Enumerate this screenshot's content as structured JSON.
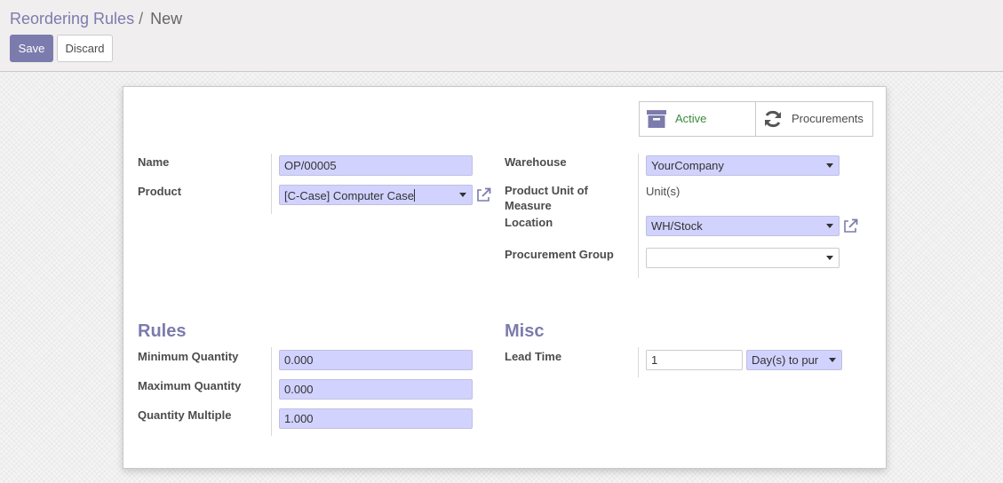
{
  "breadcrumb": {
    "parent": "Reordering Rules",
    "separator": "/",
    "current": "New"
  },
  "buttons": {
    "save": "Save",
    "discard": "Discard"
  },
  "button_box": {
    "active": "Active",
    "procurements": "Procurements"
  },
  "fields": {
    "name": {
      "label": "Name",
      "value": "OP/00005"
    },
    "product": {
      "label": "Product",
      "value": "[C-Case] Computer Case"
    },
    "warehouse": {
      "label": "Warehouse",
      "value": "YourCompany"
    },
    "uom": {
      "label": "Product Unit of Measure",
      "value": "Unit(s)"
    },
    "location": {
      "label": "Location",
      "value": "WH/Stock"
    },
    "procurement_group": {
      "label": "Procurement Group",
      "value": ""
    }
  },
  "rules": {
    "title": "Rules",
    "min_qty": {
      "label": "Minimum Quantity",
      "value": "0.000"
    },
    "max_qty": {
      "label": "Maximum Quantity",
      "value": "0.000"
    },
    "qty_multiple": {
      "label": "Quantity Multiple",
      "value": "1.000"
    }
  },
  "misc": {
    "title": "Misc",
    "lead_time": {
      "label": "Lead Time",
      "value": "1",
      "unit": "Day(s) to pur"
    }
  },
  "colors": {
    "accent": "#7c7bad",
    "input_bg": "#d2d2ff",
    "active_green": "#3b8a3b"
  }
}
